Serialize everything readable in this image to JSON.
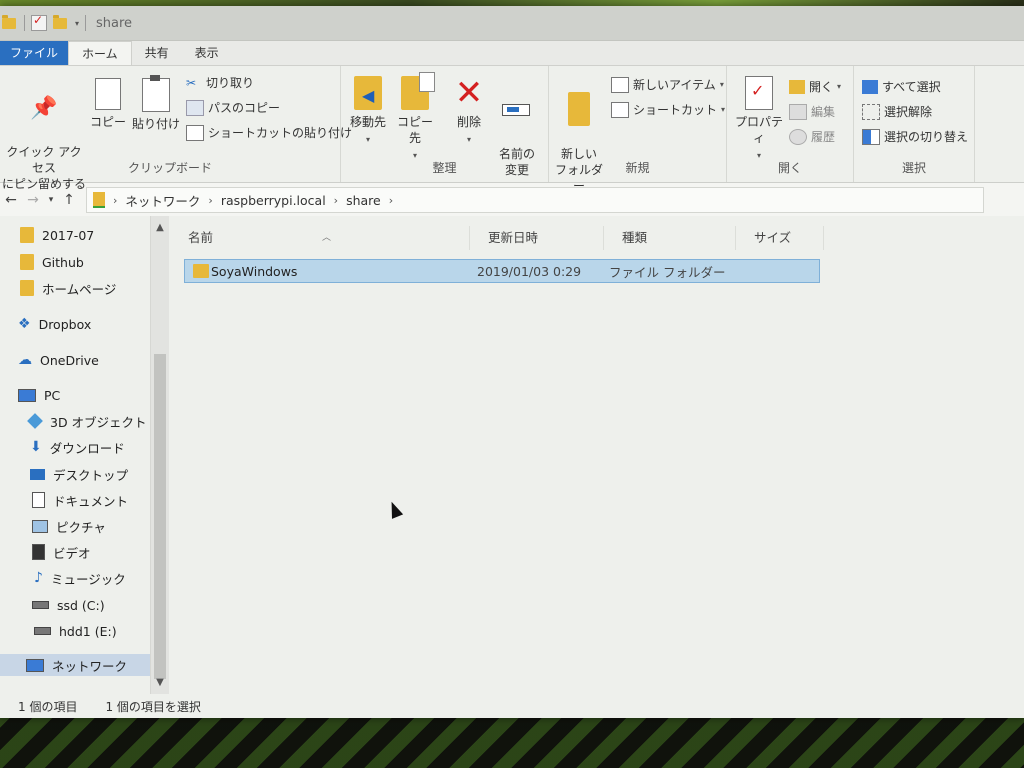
{
  "window": {
    "title": "share"
  },
  "ribbon_tabs": [
    "ファイル",
    "ホーム",
    "共有",
    "表示"
  ],
  "ribbon": {
    "clipboard": {
      "label": "クリップボード",
      "pin": "クイック アクセス\nにピン留めする",
      "copy": "コピー",
      "paste": "貼り付け",
      "cut": "切り取り",
      "copy_path": "パスのコピー",
      "paste_shortcut": "ショートカットの貼り付け"
    },
    "organize": {
      "label": "整理",
      "move_to": "移動先",
      "copy_to": "コピー先",
      "delete": "削除",
      "rename": "名前の\n変更"
    },
    "new": {
      "label": "新規",
      "new_folder": "新しい\nフォルダー",
      "new_item": "新しいアイテム",
      "shortcut": "ショートカット"
    },
    "open": {
      "label": "開く",
      "properties": "プロパティ",
      "open": "開く",
      "edit": "編集",
      "history": "履歴"
    },
    "select": {
      "label": "選択",
      "select_all": "すべて選択",
      "select_none": "選択解除",
      "invert": "選択の切り替え"
    }
  },
  "breadcrumb": [
    "ネットワーク",
    "raspberrypi.local",
    "share"
  ],
  "nav": {
    "items": [
      {
        "label": "2017-07",
        "icon": "folder-icon"
      },
      {
        "label": "Github",
        "icon": "folder-icon"
      },
      {
        "label": "ホームページ",
        "icon": "folder-icon"
      },
      {
        "label": "Dropbox",
        "icon": "dropbox-icon"
      },
      {
        "label": "OneDrive",
        "icon": "onedrive-icon"
      },
      {
        "label": "PC",
        "icon": "pc-icon"
      },
      {
        "label": "3D オブジェクト",
        "icon": "cube-icon"
      },
      {
        "label": "ダウンロード",
        "icon": "download-icon"
      },
      {
        "label": "デスクトップ",
        "icon": "desktop-icon"
      },
      {
        "label": "ドキュメント",
        "icon": "document-icon"
      },
      {
        "label": "ピクチャ",
        "icon": "picture-icon"
      },
      {
        "label": "ビデオ",
        "icon": "video-icon"
      },
      {
        "label": "ミュージック",
        "icon": "music-icon"
      },
      {
        "label": "ssd (C:)",
        "icon": "drive-icon"
      },
      {
        "label": "hdd1 (E:)",
        "icon": "drive-icon"
      },
      {
        "label": "ネットワーク",
        "icon": "network-icon"
      }
    ]
  },
  "columns": [
    "名前",
    "更新日時",
    "種類",
    "サイズ"
  ],
  "files": [
    {
      "name": "SoyaWindows",
      "modified": "2019/01/03 0:29",
      "type": "ファイル フォルダー",
      "size": ""
    }
  ],
  "status": {
    "count": "1 個の項目",
    "selected": "1 個の項目を選択"
  }
}
